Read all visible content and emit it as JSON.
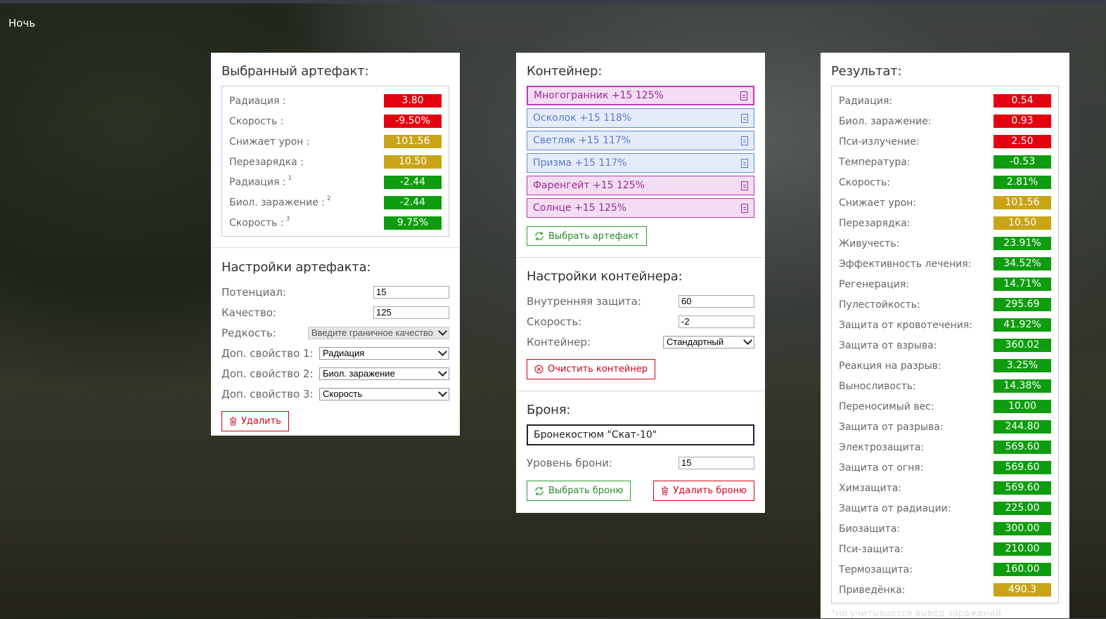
{
  "header": {
    "mode": "Ночь"
  },
  "colors": {
    "red": "#e3000f",
    "yellow": "#c9a416",
    "green": "#0f9d0f",
    "purple": "#b33ab3",
    "blue": "#6b8ad6"
  },
  "selected_artifact": {
    "title": "Выбранный артефакт:",
    "stats": [
      {
        "label": "Радиация :",
        "sup": "",
        "value": "3.80",
        "color": "red"
      },
      {
        "label": "Скорость :",
        "sup": "",
        "value": "-9.50%",
        "color": "red"
      },
      {
        "label": "Снижает урон :",
        "sup": "",
        "value": "101.56",
        "color": "yellow"
      },
      {
        "label": "Перезарядка :",
        "sup": "",
        "value": "10.50",
        "color": "yellow"
      },
      {
        "label": "Радиация :",
        "sup": "1",
        "value": "-2.44",
        "color": "green"
      },
      {
        "label": "Биол. заражение :",
        "sup": "2",
        "value": "-2.44",
        "color": "green"
      },
      {
        "label": "Скорость :",
        "sup": "3",
        "value": "9.75%",
        "color": "green"
      }
    ]
  },
  "artifact_settings": {
    "title": "Настройки артефакта:",
    "potential_label": "Потенциал:",
    "potential_value": "15",
    "quality_label": "Качество:",
    "quality_value": "125",
    "rarity_label": "Редкость:",
    "rarity_value": "Введите граничное качество",
    "extra1_label": "Доп. свойство 1:",
    "extra1_value": "Радиация",
    "extra2_label": "Доп. свойство 2:",
    "extra2_value": "Биол. заражение",
    "extra3_label": "Доп. свойство 3:",
    "extra3_value": "Скорость",
    "delete_label": "Удалить"
  },
  "container": {
    "title": "Контейнер:",
    "items": [
      {
        "label": "Многогранник +15 125%",
        "color": "purple",
        "active": true
      },
      {
        "label": "Осколок +15 118%",
        "color": "blue",
        "active": false
      },
      {
        "label": "Светляк +15 117%",
        "color": "blue",
        "active": false
      },
      {
        "label": "Призма +15 117%",
        "color": "blue",
        "active": false
      },
      {
        "label": "Фаренгейт +15 125%",
        "color": "purple",
        "active": false
      },
      {
        "label": "Солнце +15 125%",
        "color": "purple",
        "active": false
      }
    ],
    "choose_label": "Выбрать артефакт"
  },
  "container_settings": {
    "title": "Настройки контейнера:",
    "protection_label": "Внутренняя защита:",
    "protection_value": "60",
    "speed_label": "Скорость:",
    "speed_value": "-2",
    "type_label": "Контейнер:",
    "type_value": "Стандартный",
    "clear_label": "Очистить контейнер"
  },
  "armor": {
    "title": "Броня:",
    "name": "Бронекостюм \"Скат-10\"",
    "level_label": "Уровень брони:",
    "level_value": "15",
    "choose_label": "Выбрать броню",
    "delete_label": "Удалить броню"
  },
  "result": {
    "title": "Результат:",
    "stats": [
      {
        "label": "Радиация:",
        "value": "0.54",
        "color": "red"
      },
      {
        "label": "Биол. заражение:",
        "value": "0.93",
        "color": "red"
      },
      {
        "label": "Пси-излучение:",
        "value": "2.50",
        "color": "red"
      },
      {
        "label": "Температура:",
        "value": "-0.53",
        "color": "green"
      },
      {
        "label": "Скорость:",
        "value": "2.81%",
        "color": "green"
      },
      {
        "label": "Снижает урон:",
        "value": "101.56",
        "color": "yellow"
      },
      {
        "label": "Перезарядка:",
        "value": "10.50",
        "color": "yellow"
      },
      {
        "label": "Живучесть:",
        "value": "23.91%",
        "color": "green"
      },
      {
        "label": "Эффективность лечения:",
        "value": "34.52%",
        "color": "green"
      },
      {
        "label": "Регенерация:",
        "value": "14.71%",
        "color": "green"
      },
      {
        "label": "Пулестойкость:",
        "value": "295.69",
        "color": "green"
      },
      {
        "label": "Защита от кровотечения:",
        "value": "41.92%",
        "color": "green"
      },
      {
        "label": "Защита от взрыва:",
        "value": "360.02",
        "color": "green"
      },
      {
        "label": "Реакция на разрыв:",
        "value": "3.25%",
        "color": "green"
      },
      {
        "label": "Выносливость:",
        "value": "14.38%",
        "color": "green"
      },
      {
        "label": "Переносимый вес:",
        "value": "10.00",
        "color": "green"
      },
      {
        "label": "Защита от разрыва:",
        "value": "244.80",
        "color": "green"
      },
      {
        "label": "Электрозащита:",
        "value": "569.60",
        "color": "green"
      },
      {
        "label": "Защита от огня:",
        "value": "569.60",
        "color": "green"
      },
      {
        "label": "Химзащита:",
        "value": "569.60",
        "color": "green"
      },
      {
        "label": "Защита от радиации:",
        "value": "225.00",
        "color": "green"
      },
      {
        "label": "Биозащита:",
        "value": "300.00",
        "color": "green"
      },
      {
        "label": "Пси-защита:",
        "value": "210.00",
        "color": "green"
      },
      {
        "label": "Термозащита:",
        "value": "160.00",
        "color": "green"
      },
      {
        "label": "Приведёнка:",
        "value": "490.3",
        "color": "yellow"
      }
    ],
    "footnote": "*не учитывается вывод заражений"
  }
}
